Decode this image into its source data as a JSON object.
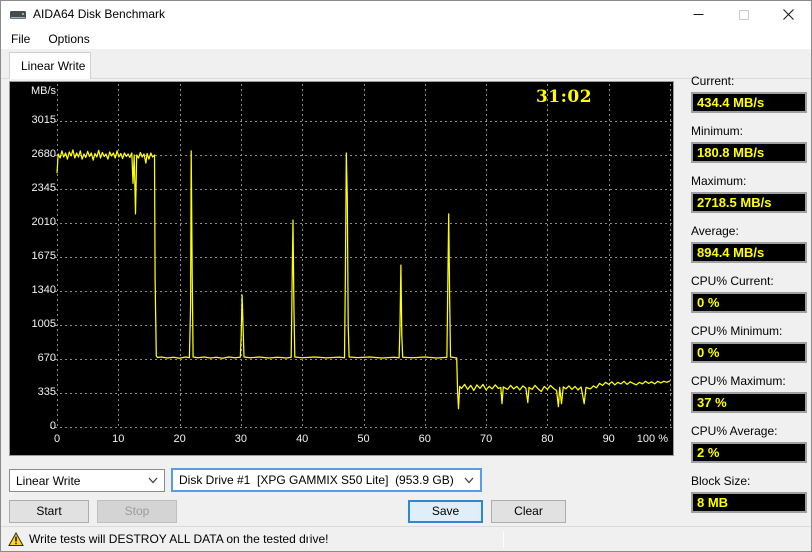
{
  "window": {
    "title": "AIDA64 Disk Benchmark"
  },
  "menu": {
    "items": [
      {
        "label": "File"
      },
      {
        "label": "Options"
      }
    ]
  },
  "tabs": {
    "active_label": "Linear Write"
  },
  "chart_data": {
    "type": "line",
    "title": "Linear Write benchmark trace",
    "unit_label": "MB/s",
    "elapsed_time": "31:02",
    "xlim": [
      0,
      100
    ],
    "ylim": [
      0,
      3350
    ],
    "y_ticks": [
      3015,
      2680,
      2345,
      2010,
      1675,
      1340,
      1005,
      670,
      335,
      0
    ],
    "x_tick_labels": [
      "0",
      "10",
      "20",
      "30",
      "40",
      "50",
      "60",
      "70",
      "80",
      "90",
      "100 %"
    ],
    "grid": true,
    "legend_position": "none",
    "line_color": "#ffff00",
    "background": "#000000",
    "series": [
      {
        "name": "Linear Write",
        "points": [
          [
            0,
            2500
          ],
          [
            0.2,
            2690
          ],
          [
            0.5,
            2650
          ],
          [
            0.8,
            2720
          ],
          [
            1.1,
            2660
          ],
          [
            1.4,
            2700
          ],
          [
            1.7,
            2640
          ],
          [
            2,
            2710
          ],
          [
            2.3,
            2670
          ],
          [
            2.6,
            2730
          ],
          [
            2.9,
            2650
          ],
          [
            3.2,
            2700
          ],
          [
            3.5,
            2660
          ],
          [
            3.8,
            2720
          ],
          [
            4.1,
            2640
          ],
          [
            4.4,
            2690
          ],
          [
            4.7,
            2655
          ],
          [
            5,
            2715
          ],
          [
            5.3,
            2665
          ],
          [
            5.6,
            2700
          ],
          [
            5.9,
            2630
          ],
          [
            6.2,
            2695
          ],
          [
            6.5,
            2660
          ],
          [
            6.8,
            2725
          ],
          [
            7.1,
            2650
          ],
          [
            7.4,
            2705
          ],
          [
            7.7,
            2665
          ],
          [
            8,
            2690
          ],
          [
            8.3,
            2640
          ],
          [
            8.6,
            2710
          ],
          [
            8.9,
            2670
          ],
          [
            9.2,
            2700
          ],
          [
            9.5,
            2650
          ],
          [
            9.8,
            2720
          ],
          [
            10.1,
            2660
          ],
          [
            10.4,
            2695
          ],
          [
            10.7,
            2645
          ],
          [
            11,
            2700
          ],
          [
            11.3,
            2665
          ],
          [
            11.6,
            2690
          ],
          [
            11.9,
            2655
          ],
          [
            12.2,
            2700
          ],
          [
            12.4,
            2400
          ],
          [
            12.6,
            2680
          ],
          [
            12.8,
            2100
          ],
          [
            13,
            2680
          ],
          [
            13.3,
            2650
          ],
          [
            13.6,
            2705
          ],
          [
            13.9,
            2660
          ],
          [
            14.2,
            2690
          ],
          [
            14.5,
            2600
          ],
          [
            14.7,
            2695
          ],
          [
            15,
            2640
          ],
          [
            15.3,
            2700
          ],
          [
            15.6,
            2660
          ],
          [
            15.9,
            2680
          ],
          [
            16,
            1450
          ],
          [
            16.2,
            700
          ],
          [
            16.4,
            685
          ],
          [
            17,
            690
          ],
          [
            18,
            680
          ],
          [
            19,
            688
          ],
          [
            20,
            678
          ],
          [
            21,
            690
          ],
          [
            21.6,
            683
          ],
          [
            21.8,
            1200
          ],
          [
            21.9,
            2720
          ],
          [
            22.05,
            1500
          ],
          [
            22.2,
            690
          ],
          [
            23,
            682
          ],
          [
            24,
            690
          ],
          [
            25,
            680
          ],
          [
            26,
            688
          ],
          [
            27,
            678
          ],
          [
            28,
            690
          ],
          [
            29,
            682
          ],
          [
            29.9,
            688
          ],
          [
            30.05,
            900
          ],
          [
            30.2,
            1300
          ],
          [
            30.35,
            1000
          ],
          [
            30.5,
            690
          ],
          [
            31.5,
            682
          ],
          [
            33,
            690
          ],
          [
            34.5,
            680
          ],
          [
            36,
            688
          ],
          [
            37.5,
            680
          ],
          [
            38.2,
            688
          ],
          [
            38.35,
            1400
          ],
          [
            38.5,
            2040
          ],
          [
            38.65,
            1200
          ],
          [
            38.8,
            690
          ],
          [
            40,
            682
          ],
          [
            42,
            690
          ],
          [
            44,
            681
          ],
          [
            46,
            689
          ],
          [
            46.9,
            683
          ],
          [
            47.05,
            1500
          ],
          [
            47.2,
            2700
          ],
          [
            47.35,
            2250
          ],
          [
            47.5,
            1000
          ],
          [
            47.65,
            690
          ],
          [
            49,
            684
          ],
          [
            51,
            690
          ],
          [
            53,
            680
          ],
          [
            55,
            688
          ],
          [
            55.8,
            682
          ],
          [
            55.95,
            1000
          ],
          [
            56.1,
            1595
          ],
          [
            56.25,
            900
          ],
          [
            56.4,
            688
          ],
          [
            58,
            682
          ],
          [
            60,
            690
          ],
          [
            62,
            680
          ],
          [
            63.6,
            688
          ],
          [
            63.75,
            1400
          ],
          [
            63.9,
            2100
          ],
          [
            64.05,
            1300
          ],
          [
            64.2,
            690
          ],
          [
            64.8,
            685
          ],
          [
            65.2,
            680
          ],
          [
            65.35,
            350
          ],
          [
            65.5,
            180
          ],
          [
            65.7,
            400
          ],
          [
            66,
            380
          ],
          [
            66.5,
            420
          ],
          [
            67,
            370
          ],
          [
            67.5,
            410
          ],
          [
            68,
            360
          ],
          [
            68.5,
            415
          ],
          [
            69,
            380
          ],
          [
            69.5,
            420
          ],
          [
            70,
            365
          ],
          [
            70.5,
            400
          ],
          [
            71,
            375
          ],
          [
            71.5,
            415
          ],
          [
            72,
            380
          ],
          [
            72.4,
            390
          ],
          [
            72.6,
            230
          ],
          [
            72.8,
            395
          ],
          [
            73.5,
            370
          ],
          [
            74,
            410
          ],
          [
            74.5,
            375
          ],
          [
            75,
            400
          ],
          [
            75.5,
            365
          ],
          [
            76,
            405
          ],
          [
            76.5,
            380
          ],
          [
            76.8,
            240
          ],
          [
            77,
            390
          ],
          [
            77.5,
            370
          ],
          [
            78,
            410
          ],
          [
            78.5,
            375
          ],
          [
            79,
            350
          ],
          [
            79.5,
            400
          ],
          [
            80,
            370
          ],
          [
            80.5,
            410
          ],
          [
            81,
            380
          ],
          [
            81.5,
            360
          ],
          [
            81.8,
            200
          ],
          [
            82,
            390
          ],
          [
            82.3,
            230
          ],
          [
            82.6,
            395
          ],
          [
            83,
            375
          ],
          [
            83.5,
            405
          ],
          [
            84,
            370
          ],
          [
            84.5,
            400
          ],
          [
            85,
            365
          ],
          [
            85.5,
            395
          ],
          [
            86,
            230
          ],
          [
            86.3,
            390
          ],
          [
            87,
            375
          ],
          [
            87.5,
            405
          ],
          [
            88,
            385
          ],
          [
            88.5,
            430
          ],
          [
            89,
            410
          ],
          [
            89.5,
            440
          ],
          [
            90,
            420
          ],
          [
            90.5,
            445
          ],
          [
            91,
            415
          ],
          [
            91.5,
            440
          ],
          [
            92,
            425
          ],
          [
            92.5,
            450
          ],
          [
            93,
            420
          ],
          [
            93.5,
            445
          ],
          [
            94,
            430
          ],
          [
            94.5,
            415
          ],
          [
            95,
            440
          ],
          [
            95.5,
            425
          ],
          [
            96,
            450
          ],
          [
            96.5,
            430
          ],
          [
            97,
            445
          ],
          [
            97.5,
            425
          ],
          [
            98,
            450
          ],
          [
            98.5,
            435
          ],
          [
            99,
            450
          ],
          [
            99.5,
            440
          ],
          [
            100,
            455
          ]
        ]
      }
    ]
  },
  "stats": [
    {
      "label": "Current:",
      "value": "434.4 MB/s"
    },
    {
      "label": "Minimum:",
      "value": "180.8 MB/s"
    },
    {
      "label": "Maximum:",
      "value": "2718.5 MB/s"
    },
    {
      "label": "Average:",
      "value": "894.4 MB/s"
    },
    {
      "label": "CPU% Current:",
      "value": "0 %"
    },
    {
      "label": "CPU% Minimum:",
      "value": "0 %"
    },
    {
      "label": "CPU% Maximum:",
      "value": "37 %"
    },
    {
      "label": "CPU% Average:",
      "value": "2 %"
    },
    {
      "label": "Block Size:",
      "value": "8 MB"
    }
  ],
  "controls": {
    "test_select_value": "Linear Write",
    "drive_select_value": "Disk Drive #1  [XPG GAMMIX S50 Lite]  (953.9 GB)",
    "start_label": "Start",
    "stop_label": "Stop",
    "save_label": "Save",
    "clear_label": "Clear"
  },
  "status_bar": {
    "warning_text": "Write tests will DESTROY ALL DATA on the tested drive!"
  },
  "colors": {
    "accent": "#0078d7",
    "trace": "#ffff00",
    "value_fg": "#ffff00",
    "value_bg": "#000000",
    "grid": "#8a8a8a"
  }
}
